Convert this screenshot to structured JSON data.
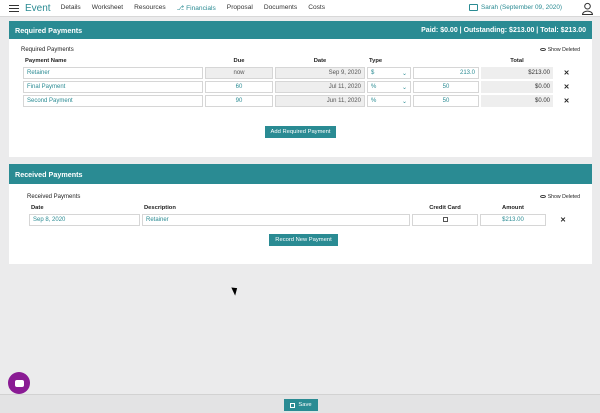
{
  "nav": {
    "brand": "Event",
    "items": [
      "Details",
      "Worksheet",
      "Resources",
      "Financials",
      "Proposal",
      "Documents",
      "Costs"
    ],
    "active_item": "Financials",
    "user": "Sarah (September 09, 2020)"
  },
  "required": {
    "title": "Required Payments",
    "summary": "Paid: $0.00 | Outstanding: $213.00 | Total: $213.00",
    "subtitle": "Required Payments",
    "show_deleted": "Show Deleted",
    "columns": [
      "Payment Name",
      "Due",
      "Date",
      "Type",
      "Total"
    ],
    "rows": [
      {
        "name": "Retainer",
        "due": "now",
        "date": "Sep 9, 2020",
        "type": "$",
        "amount": "213.0",
        "total": "$213.00"
      },
      {
        "name": "Final Payment",
        "due": "60",
        "date": "Jul 11, 2020",
        "type": "%",
        "amount": "50",
        "total": "$0.00"
      },
      {
        "name": "Second Payment",
        "due": "90",
        "date": "Jun 11, 2020",
        "type": "%",
        "amount": "50",
        "total": "$0.00"
      }
    ],
    "add_button": "Add Required Payment"
  },
  "received": {
    "title": "Received Payments",
    "subtitle": "Received Payments",
    "show_deleted": "Show Deleted",
    "columns": [
      "Date",
      "Description",
      "Credit Card",
      "Amount"
    ],
    "rows": [
      {
        "date": "Sep 8, 2020",
        "description": "Retainer",
        "amount": "$213.00"
      }
    ],
    "record_button": "Record New Payment"
  },
  "footer": {
    "save_label": "Save"
  },
  "colors": {
    "accent": "#2a8b93",
    "chat": "#8a1b94"
  }
}
